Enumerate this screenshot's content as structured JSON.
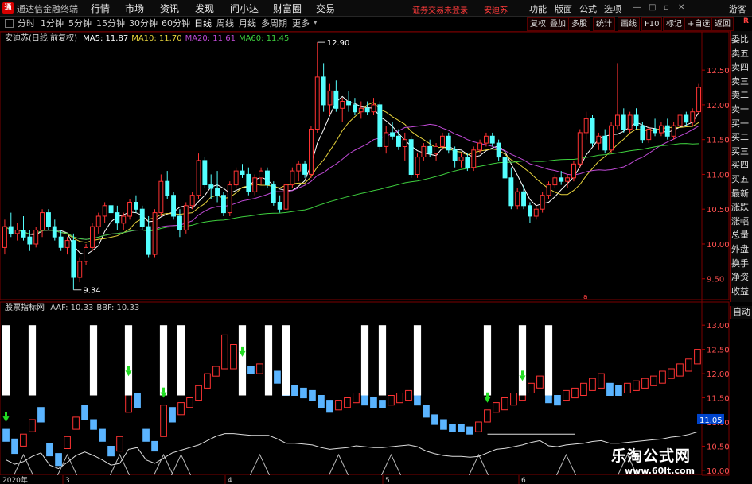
{
  "app": {
    "logo": "通",
    "name": "通达信金融终端"
  },
  "menu": [
    "行情",
    "市场",
    "资讯",
    "发现",
    "问小达",
    "财富圈",
    "交易"
  ],
  "warning": "证券交易未登录",
  "stock_name_menu": "安迪苏",
  "right_menu": [
    "功能",
    "版面",
    "公式",
    "选项"
  ],
  "guest": "游客",
  "toolbar": {
    "periods": [
      "分时",
      "1分钟",
      "5分钟",
      "15分钟",
      "30分钟",
      "60分钟",
      "日线",
      "周线",
      "月线",
      "多周期",
      "更多"
    ],
    "active_period": "日线",
    "buttons": [
      "复权",
      "叠加",
      "多股",
      "统计",
      "画线",
      "F10",
      "标记",
      "+自选",
      "返回"
    ]
  },
  "quote_panel": [
    "委比",
    "卖五",
    "卖四",
    "卖三",
    "卖二",
    "卖一",
    "买一",
    "买二",
    "买三",
    "买四",
    "买五",
    "最新",
    "涨跌",
    "涨幅",
    "总量",
    "外盘",
    "换手",
    "净资",
    "收益"
  ],
  "quote_corner": "R",
  "auto_button": "自动",
  "price_legend": {
    "name": "安迪苏(日线 前复权)",
    "items": [
      {
        "label": "MA5: 11.87",
        "color": "#ffffff"
      },
      {
        "label": "MA10: 11.70",
        "color": "#e6d23c"
      },
      {
        "label": "MA20: 11.61",
        "color": "#c04ad6"
      },
      {
        "label": "MA60: 11.45",
        "color": "#3ecf3e"
      }
    ]
  },
  "indicator_legend": {
    "name": "股票指标网",
    "items": [
      {
        "label": "AAF: 10.33",
        "color": "#cccccc"
      },
      {
        "label": "BBF: 10.33",
        "color": "#cccccc"
      }
    ]
  },
  "annotations": {
    "high": "12.90",
    "low": "9.34",
    "marker": "a",
    "current_tag": "11.05"
  },
  "date_labels": {
    "year": "2020年",
    "months": [
      "3",
      "4",
      "5",
      "6"
    ]
  },
  "watermark": {
    "brand": "乐淘公式网",
    "url": "www.60lt.com"
  },
  "chart_data": {
    "type": "candlestick",
    "up_color": "#ff3333",
    "down_color": "#54ffff",
    "price_axis": {
      "ticks": [
        9.5,
        10.0,
        10.5,
        11.0,
        11.5,
        12.0,
        12.5
      ],
      "ylim": [
        9.2,
        13.05
      ]
    },
    "indicator_axis": {
      "ticks": [
        10.0,
        10.5,
        11.0,
        11.5,
        12.0,
        12.5,
        13.0
      ],
      "ylim": [
        9.9,
        13.2
      ]
    },
    "ohlc": [
      [
        9.95,
        10.35,
        9.85,
        10.25
      ],
      [
        10.25,
        10.45,
        10.1,
        10.15
      ],
      [
        10.15,
        10.3,
        10.05,
        10.2
      ],
      [
        10.2,
        10.4,
        10.05,
        10.1
      ],
      [
        10.1,
        10.2,
        9.9,
        10.0
      ],
      [
        10.0,
        10.25,
        9.95,
        10.2
      ],
      [
        10.2,
        10.5,
        10.1,
        10.45
      ],
      [
        10.45,
        10.5,
        10.2,
        10.25
      ],
      [
        10.25,
        10.35,
        10.05,
        10.1
      ],
      [
        10.1,
        10.2,
        9.9,
        9.95
      ],
      [
        9.95,
        10.1,
        9.85,
        10.05
      ],
      [
        10.05,
        10.15,
        9.34,
        9.52
      ],
      [
        9.52,
        9.8,
        9.45,
        9.75
      ],
      [
        9.75,
        10.0,
        9.7,
        9.95
      ],
      [
        9.95,
        10.3,
        9.9,
        10.25
      ],
      [
        10.25,
        10.45,
        10.15,
        10.4
      ],
      [
        10.4,
        10.6,
        10.3,
        10.55
      ],
      [
        10.55,
        10.7,
        10.35,
        10.45
      ],
      [
        10.45,
        10.55,
        10.2,
        10.3
      ],
      [
        10.3,
        10.45,
        10.2,
        10.4
      ],
      [
        10.4,
        10.65,
        10.35,
        10.6
      ],
      [
        10.6,
        10.7,
        10.45,
        10.5
      ],
      [
        10.5,
        10.55,
        10.2,
        10.25
      ],
      [
        10.25,
        10.4,
        9.8,
        9.85
      ],
      [
        9.85,
        10.5,
        9.8,
        10.45
      ],
      [
        10.45,
        11.0,
        10.4,
        10.9
      ],
      [
        10.9,
        11.05,
        10.65,
        10.7
      ],
      [
        10.7,
        10.75,
        10.35,
        10.4
      ],
      [
        10.4,
        10.5,
        10.1,
        10.2
      ],
      [
        10.2,
        10.6,
        10.15,
        10.55
      ],
      [
        10.55,
        10.75,
        10.5,
        10.7
      ],
      [
        10.7,
        11.3,
        10.65,
        11.2
      ],
      [
        11.2,
        11.25,
        10.8,
        10.85
      ],
      [
        10.85,
        11.0,
        10.65,
        10.8
      ],
      [
        10.8,
        11.05,
        10.6,
        10.7
      ],
      [
        10.7,
        10.75,
        10.4,
        10.45
      ],
      [
        10.45,
        10.9,
        10.4,
        10.85
      ],
      [
        10.85,
        11.1,
        10.8,
        11.05
      ],
      [
        11.05,
        11.15,
        10.95,
        11.0
      ],
      [
        11.0,
        11.1,
        10.7,
        10.75
      ],
      [
        10.75,
        11.0,
        10.7,
        10.95
      ],
      [
        10.95,
        11.1,
        10.85,
        11.05
      ],
      [
        11.05,
        11.1,
        10.8,
        10.85
      ],
      [
        10.85,
        10.9,
        10.55,
        10.6
      ],
      [
        10.6,
        10.7,
        10.45,
        10.5
      ],
      [
        10.5,
        10.9,
        10.45,
        10.85
      ],
      [
        10.85,
        11.1,
        10.8,
        11.05
      ],
      [
        11.05,
        11.2,
        10.9,
        11.15
      ],
      [
        11.15,
        11.2,
        10.95,
        11.0
      ],
      [
        11.0,
        11.7,
        10.95,
        11.65
      ],
      [
        11.65,
        12.9,
        11.6,
        12.4
      ],
      [
        12.4,
        12.6,
        11.9,
        12.0
      ],
      [
        12.0,
        12.3,
        11.85,
        12.2
      ],
      [
        12.2,
        12.35,
        11.9,
        11.95
      ],
      [
        11.95,
        12.1,
        11.75,
        12.05
      ],
      [
        12.05,
        12.2,
        11.9,
        12.0
      ],
      [
        12.0,
        12.1,
        11.85,
        11.9
      ],
      [
        11.9,
        12.05,
        11.8,
        11.95
      ],
      [
        11.95,
        12.05,
        11.85,
        11.9
      ],
      [
        11.9,
        12.1,
        11.85,
        12.0
      ],
      [
        12.0,
        12.05,
        11.35,
        11.4
      ],
      [
        11.4,
        11.7,
        11.3,
        11.6
      ],
      [
        11.6,
        11.75,
        11.5,
        11.55
      ],
      [
        11.55,
        11.65,
        11.35,
        11.4
      ],
      [
        11.4,
        11.6,
        11.2,
        11.5
      ],
      [
        11.5,
        11.55,
        10.95,
        11.0
      ],
      [
        11.0,
        11.3,
        10.95,
        11.25
      ],
      [
        11.25,
        11.45,
        11.2,
        11.4
      ],
      [
        11.4,
        11.5,
        11.25,
        11.3
      ],
      [
        11.3,
        11.45,
        11.2,
        11.4
      ],
      [
        11.4,
        11.6,
        11.35,
        11.55
      ],
      [
        11.55,
        11.6,
        11.3,
        11.35
      ],
      [
        11.35,
        11.4,
        11.1,
        11.2
      ],
      [
        11.2,
        11.3,
        11.1,
        11.25
      ],
      [
        11.25,
        11.3,
        11.05,
        11.1
      ],
      [
        11.1,
        11.4,
        11.05,
        11.35
      ],
      [
        11.35,
        11.5,
        11.3,
        11.45
      ],
      [
        11.45,
        11.6,
        11.4,
        11.55
      ],
      [
        11.55,
        11.6,
        11.4,
        11.45
      ],
      [
        11.45,
        11.5,
        11.2,
        11.25
      ],
      [
        11.25,
        11.35,
        10.9,
        10.95
      ],
      [
        10.95,
        11.1,
        10.5,
        10.55
      ],
      [
        10.55,
        10.8,
        10.5,
        10.75
      ],
      [
        10.75,
        10.85,
        10.5,
        10.55
      ],
      [
        10.55,
        10.6,
        10.3,
        10.4
      ],
      [
        10.4,
        10.55,
        10.35,
        10.5
      ],
      [
        10.5,
        10.75,
        10.45,
        10.7
      ],
      [
        10.7,
        10.9,
        10.65,
        10.85
      ],
      [
        10.85,
        11.0,
        10.8,
        10.95
      ],
      [
        10.95,
        11.05,
        10.85,
        10.9
      ],
      [
        10.9,
        11.0,
        10.8,
        10.95
      ],
      [
        10.95,
        11.2,
        10.9,
        11.15
      ],
      [
        11.15,
        11.65,
        11.1,
        11.6
      ],
      [
        11.6,
        11.9,
        11.5,
        11.8
      ],
      [
        11.8,
        11.85,
        11.4,
        11.45
      ],
      [
        11.45,
        11.6,
        11.35,
        11.55
      ],
      [
        11.55,
        11.65,
        11.3,
        11.35
      ],
      [
        11.35,
        11.75,
        11.3,
        11.7
      ],
      [
        11.7,
        12.6,
        11.65,
        11.85
      ],
      [
        11.85,
        11.95,
        11.6,
        11.65
      ],
      [
        11.65,
        11.9,
        11.6,
        11.85
      ],
      [
        11.85,
        11.95,
        11.65,
        11.7
      ],
      [
        11.7,
        11.75,
        11.45,
        11.5
      ],
      [
        11.5,
        11.7,
        11.45,
        11.65
      ],
      [
        11.65,
        11.8,
        11.55,
        11.6
      ],
      [
        11.6,
        11.75,
        11.55,
        11.7
      ],
      [
        11.7,
        11.8,
        11.5,
        11.55
      ],
      [
        11.55,
        11.75,
        11.5,
        11.7
      ],
      [
        11.7,
        11.9,
        11.65,
        11.85
      ],
      [
        11.85,
        11.9,
        11.7,
        11.75
      ],
      [
        11.75,
        11.95,
        11.7,
        11.9
      ],
      [
        11.9,
        12.3,
        11.85,
        12.25
      ]
    ],
    "indicator": {
      "blocks": [
        [
          10.6,
          10.85,
          "d"
        ],
        [
          10.35,
          10.65,
          "d"
        ],
        [
          10.5,
          10.75,
          "u"
        ],
        [
          10.8,
          11.05,
          "u"
        ],
        [
          11.0,
          11.3,
          "d"
        ],
        [
          10.3,
          10.55,
          "d"
        ],
        [
          10.1,
          10.35,
          "d"
        ],
        [
          10.45,
          10.7,
          "u"
        ],
        [
          10.85,
          11.1,
          "u"
        ],
        [
          11.05,
          11.35,
          "d"
        ],
        [
          10.85,
          11.05,
          "d"
        ],
        [
          10.6,
          10.85,
          "d"
        ],
        [
          10.3,
          10.5,
          "d"
        ],
        [
          10.4,
          10.7,
          "u"
        ],
        [
          11.2,
          11.8,
          "u"
        ],
        [
          11.3,
          11.6,
          "d"
        ],
        [
          10.6,
          10.85,
          "d"
        ],
        [
          10.4,
          10.6,
          "d"
        ],
        [
          10.7,
          11.35,
          "u"
        ],
        [
          11.0,
          11.3,
          "d"
        ],
        [
          11.15,
          11.4,
          "u"
        ],
        [
          11.3,
          11.5,
          "u"
        ],
        [
          11.45,
          11.75,
          "u"
        ],
        [
          11.7,
          12.0,
          "u"
        ],
        [
          11.95,
          12.15,
          "u"
        ],
        [
          12.1,
          12.8,
          "u"
        ],
        [
          12.1,
          12.6,
          "u"
        ],
        [
          12.05,
          12.2,
          "d"
        ],
        [
          12.0,
          12.15,
          "d"
        ],
        [
          12.0,
          12.2,
          "u"
        ],
        [
          12.0,
          12.25,
          "d"
        ],
        [
          11.8,
          12.05,
          "d"
        ],
        [
          11.55,
          11.85,
          "d"
        ],
        [
          11.55,
          11.75,
          "d"
        ],
        [
          11.5,
          11.7,
          "d"
        ],
        [
          11.45,
          11.65,
          "d"
        ],
        [
          11.3,
          11.55,
          "d"
        ],
        [
          11.2,
          11.45,
          "d"
        ],
        [
          11.25,
          11.45,
          "u"
        ],
        [
          11.3,
          11.5,
          "u"
        ],
        [
          11.4,
          11.6,
          "u"
        ],
        [
          11.35,
          11.55,
          "d"
        ],
        [
          11.3,
          11.5,
          "d"
        ],
        [
          11.3,
          11.45,
          "d"
        ],
        [
          11.35,
          11.55,
          "u"
        ],
        [
          11.4,
          11.6,
          "u"
        ],
        [
          11.45,
          11.65,
          "u"
        ],
        [
          11.35,
          11.55,
          "d"
        ],
        [
          11.1,
          11.35,
          "d"
        ],
        [
          10.95,
          11.15,
          "d"
        ],
        [
          10.85,
          11.05,
          "d"
        ],
        [
          10.8,
          10.95,
          "d"
        ],
        [
          10.8,
          10.95,
          "d"
        ],
        [
          10.75,
          10.9,
          "d"
        ],
        [
          10.8,
          11.0,
          "u"
        ],
        [
          11.0,
          11.25,
          "u"
        ],
        [
          11.2,
          11.4,
          "u"
        ],
        [
          11.25,
          11.5,
          "u"
        ],
        [
          11.35,
          11.6,
          "u"
        ],
        [
          11.45,
          11.7,
          "u"
        ],
        [
          11.6,
          11.8,
          "u"
        ],
        [
          11.7,
          11.95,
          "u"
        ],
        [
          11.4,
          11.6,
          "d"
        ],
        [
          11.35,
          11.55,
          "d"
        ],
        [
          11.45,
          11.65,
          "u"
        ],
        [
          11.5,
          11.7,
          "u"
        ],
        [
          11.55,
          11.8,
          "u"
        ],
        [
          11.65,
          11.9,
          "u"
        ],
        [
          11.7,
          12.0,
          "u"
        ],
        [
          11.55,
          11.8,
          "d"
        ],
        [
          11.55,
          11.75,
          "d"
        ],
        [
          11.6,
          11.8,
          "u"
        ],
        [
          11.65,
          11.85,
          "u"
        ],
        [
          11.7,
          11.9,
          "u"
        ],
        [
          11.75,
          11.95,
          "u"
        ],
        [
          11.8,
          12.05,
          "u"
        ],
        [
          11.9,
          12.1,
          "u"
        ],
        [
          11.95,
          12.2,
          "u"
        ],
        [
          12.05,
          12.3,
          "u"
        ],
        [
          12.2,
          12.5,
          "u"
        ]
      ],
      "white_bars": [
        0,
        3,
        10,
        14,
        18,
        20,
        27,
        30,
        32,
        41,
        43,
        47,
        55,
        59,
        62
      ]
    }
  }
}
